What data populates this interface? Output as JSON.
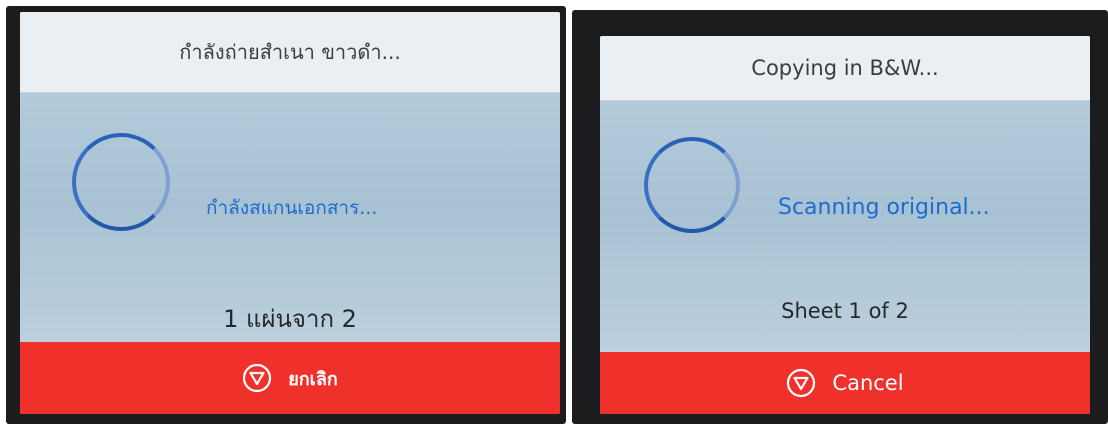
{
  "colors": {
    "header_bg": "#e9eff3",
    "content_bg": "#a9c4d6",
    "status_text": "#1e6bd0",
    "spinner": "#2a61b8",
    "cancel_bg": "#f0302a",
    "bezel": "#1c1c1e"
  },
  "panels": [
    {
      "language": "Thai",
      "header_title": "กำลังถ่ายสำเนา ขาวดำ...",
      "status_text": "กำลังสแกนเอกสาร...",
      "sheet_text": "1 แผ่นจาก 2",
      "cancel_label": "ยกเลิก",
      "cancel_icon": "stop-icon"
    },
    {
      "language": "English",
      "header_title": "Copying in B&W...",
      "status_text": "Scanning original...",
      "sheet_text": "Sheet 1 of 2",
      "cancel_label": "Cancel",
      "cancel_icon": "stop-icon"
    }
  ]
}
